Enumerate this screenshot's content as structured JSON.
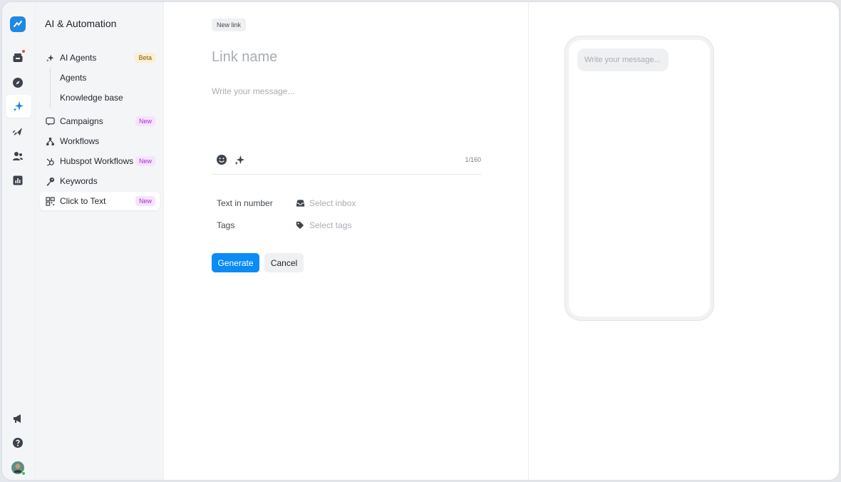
{
  "sidebar": {
    "title": "AI & Automation",
    "items": [
      {
        "label": "AI Agents",
        "badge": "Beta",
        "icon": "sparkle-icon"
      },
      {
        "label": "Campaigns",
        "badge": "New",
        "icon": "chat-icon"
      },
      {
        "label": "Workflows",
        "badge": "",
        "icon": "workflow-icon"
      },
      {
        "label": "Hubspot Workflows",
        "badge": "New",
        "icon": "hubspot-icon"
      },
      {
        "label": "Keywords",
        "badge": "",
        "icon": "key-icon"
      },
      {
        "label": "Click to Text",
        "badge": "New",
        "icon": "qr-icon"
      }
    ],
    "sub_items": [
      {
        "label": "Agents"
      },
      {
        "label": "Knowledge base"
      }
    ]
  },
  "rail": {
    "icons": [
      "logo-icon",
      "inbox-icon",
      "compass-icon",
      "sparkle-icon",
      "send-icon",
      "contacts-icon",
      "reports-icon",
      "megaphone-icon",
      "help-icon",
      "avatar"
    ]
  },
  "main": {
    "chip": "New link",
    "link_name_placeholder": "Link name",
    "message_placeholder": "Write your message...",
    "counter": "1/160",
    "fields": {
      "text_in_number_label": "Text in number",
      "text_in_number_value": "Select inbox",
      "tags_label": "Tags",
      "tags_value": "Select tags"
    },
    "buttons": {
      "generate": "Generate",
      "cancel": "Cancel"
    }
  },
  "preview": {
    "bubble": "Write your message..."
  },
  "colors": {
    "accent": "#0a8bf5",
    "badge_beta_bg": "#fbefd2",
    "badge_new_bg": "#f5e4fb",
    "badge_new_text": "#a52fcf",
    "notification_dot": "#e5484d"
  }
}
